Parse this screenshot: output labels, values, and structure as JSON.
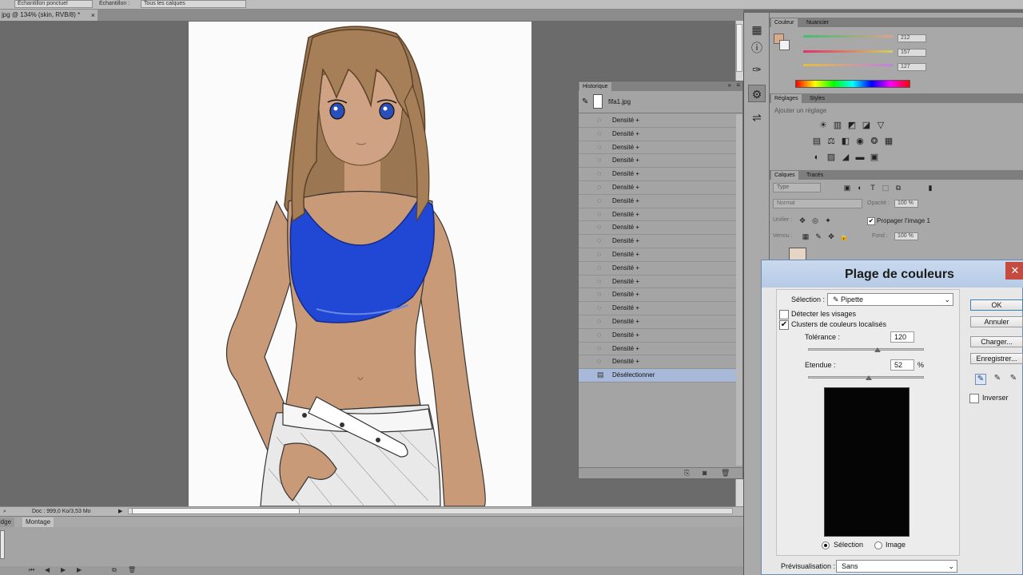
{
  "option_bar": {
    "field_1": "Échantillon ponctuel",
    "label_2": "Échantillon :",
    "field_2": "Tous les calques"
  },
  "document": {
    "tab_title": "jpg @ 134% (skin, RVB/8) *",
    "close_glyph": "×",
    "status_text": "Doc : 999,0 Ko/3,53 Mo"
  },
  "timeline": {
    "tabs": [
      "Mini Bridge",
      "Montage"
    ]
  },
  "history": {
    "tab_label": "Historique",
    "snapshot_name": "fifa1.jpg",
    "steps": [
      "Densité +",
      "Densité +",
      "Densité +",
      "Densité +",
      "Densité +",
      "Densité +",
      "Densité +",
      "Densité +",
      "Densité +",
      "Densité +",
      "Densité +",
      "Densité +",
      "Densité +",
      "Densité +",
      "Densité +",
      "Densité +",
      "Densité +",
      "Densité +",
      "Densité +",
      "Désélectionner"
    ],
    "selected_index": 19
  },
  "color_panel": {
    "tabs": [
      "Couleur",
      "Nuancier"
    ],
    "swatch": "#d9a98a",
    "values": [
      "212",
      "157",
      "127"
    ]
  },
  "adjust_panel": {
    "tabs": [
      "Réglages",
      "Styles"
    ],
    "hint": "Ajouter un réglage"
  },
  "layers_panel": {
    "tabs": [
      "Calques",
      "Tracés"
    ],
    "kind": "Type",
    "blend": "Normal",
    "opacity_label": "Opacité :",
    "opacity": "100 %",
    "lock_label": "Verrou :",
    "fill_label": "Fond :",
    "fill": "100 %",
    "unify_label": "Unifier :",
    "propagate_label": "Propager l'image 1"
  },
  "dialog": {
    "title": "Plage de couleurs",
    "close_glyph": "✕",
    "selection_label": "Sélection :",
    "selection_value": "Pipette",
    "detect_faces": "Détecter les visages",
    "local_clusters": "Clusters de couleurs localisés",
    "tolerance_label": "Tolérance :",
    "tolerance": "120",
    "range_label": "Etendue :",
    "range": "52",
    "range_unit": "%",
    "radio_selection": "Sélection",
    "radio_image": "Image",
    "preview_label": "Prévisualisation :",
    "preview_value": "Sans",
    "buttons": {
      "ok": "OK",
      "cancel": "Annuler",
      "load": "Charger...",
      "save": "Enregistrer..."
    },
    "invert": "Inverser"
  }
}
